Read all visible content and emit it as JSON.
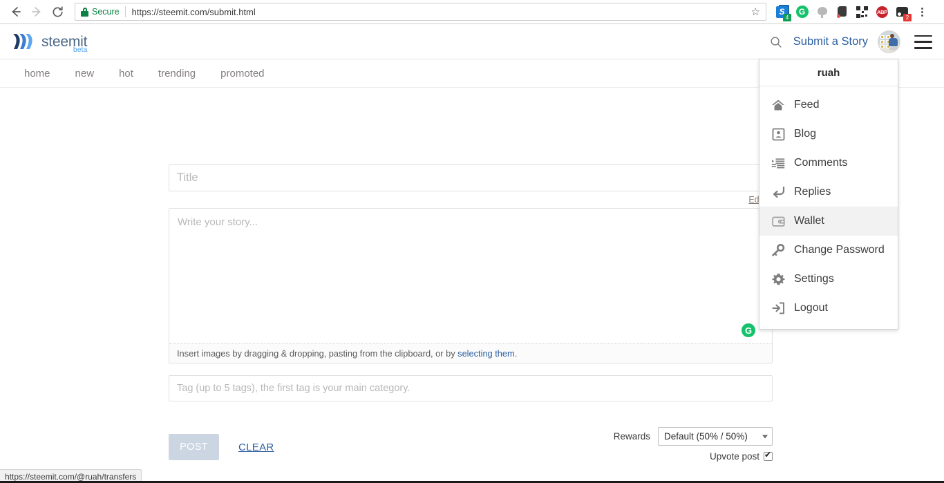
{
  "browser": {
    "back_icon": "arrow-left-icon",
    "forward_icon": "arrow-right-icon",
    "reload_icon": "reload-icon",
    "security_label": "Secure",
    "url": "https://steemit.com/submit.html",
    "bookmark_icon": "star-icon",
    "extensions": [
      {
        "name": "steem-extension",
        "glyph": "S",
        "badge": "4",
        "badge_color": "#0f9d58"
      },
      {
        "name": "grammarly-extension",
        "glyph": "G",
        "badge": "",
        "badge_color": ""
      },
      {
        "name": "balloon-extension",
        "glyph": "",
        "badge": "",
        "badge_color": ""
      },
      {
        "name": "evernote-extension",
        "glyph": "",
        "badge": "",
        "badge_color": ""
      },
      {
        "name": "qr-code-extension",
        "glyph": "",
        "badge": "",
        "badge_color": ""
      },
      {
        "name": "adblock-plus-extension",
        "glyph": "ABP",
        "badge": "",
        "badge_color": ""
      },
      {
        "name": "dark-extension",
        "glyph": "",
        "badge": "2",
        "badge_color": "#e53935"
      }
    ],
    "menu_icon": "three-dots-icon"
  },
  "site_header": {
    "brand_name": "steemit",
    "brand_beta": "beta",
    "search_icon": "search-icon",
    "submit_story": "Submit a Story",
    "avatar_alt": "ruah",
    "hamburger_icon": "hamburger-menu-icon"
  },
  "nav": {
    "items": [
      {
        "label": "home"
      },
      {
        "label": "new"
      },
      {
        "label": "hot"
      },
      {
        "label": "trending"
      },
      {
        "label": "promoted"
      }
    ]
  },
  "form": {
    "title_placeholder": "Title",
    "title_value": "",
    "editor_link": "Editor",
    "story_placeholder": "Write your story...",
    "story_value": "",
    "grammarly_badge": "G",
    "dropzone_text_before": "Insert images by dragging & dropping, pasting from the clipboard, or by ",
    "dropzone_link": "selecting them",
    "dropzone_text_after": ".",
    "tag_placeholder": "Tag (up to 5 tags), the first tag is your main category.",
    "tag_value": "",
    "post_label": "POST",
    "clear_label": "CLEAR",
    "rewards_label": "Rewards",
    "rewards_value": "Default (50% / 50%)",
    "upvote_label": "Upvote post",
    "upvote_checked": true
  },
  "user_dropdown": {
    "username": "ruah",
    "items": [
      {
        "label": "Feed",
        "icon": "home-icon",
        "active": false
      },
      {
        "label": "Blog",
        "icon": "id-card-icon",
        "active": false
      },
      {
        "label": "Comments",
        "icon": "list-icon",
        "active": false
      },
      {
        "label": "Replies",
        "icon": "reply-arrow-icon",
        "active": false
      },
      {
        "label": "Wallet",
        "icon": "wallet-icon",
        "active": true
      },
      {
        "label": "Change Password",
        "icon": "key-icon",
        "active": false
      },
      {
        "label": "Settings",
        "icon": "gear-icon",
        "active": false
      },
      {
        "label": "Logout",
        "icon": "logout-icon",
        "active": false
      }
    ]
  },
  "status_bar": {
    "url": "https://steemit.com/@ruah/transfers"
  },
  "colors": {
    "brand_blue": "#4a6786",
    "link_blue": "#2a5d9f",
    "beta_blue": "#4ba2f2",
    "secure_green": "#0b8043",
    "post_disabled": "#ccd6e3"
  }
}
